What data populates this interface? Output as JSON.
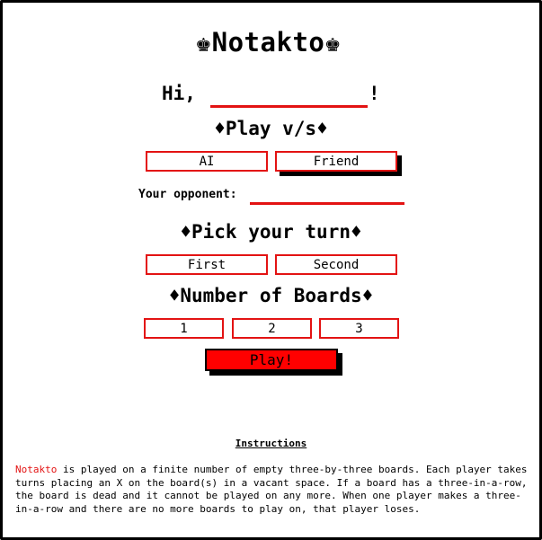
{
  "app": {
    "title": "Notakto",
    "title_icon": "chess-king-icon"
  },
  "greeting": {
    "prefix": "Hi,",
    "name_value": "",
    "suffix": "!"
  },
  "play_vs": {
    "heading": "♦Play v/s♦",
    "options": [
      "AI",
      "Friend"
    ],
    "selected": "Friend"
  },
  "opponent": {
    "label": "Your opponent:",
    "value": ""
  },
  "turn": {
    "heading": "♦Pick your turn♦",
    "options": [
      "First",
      "Second"
    ]
  },
  "boards": {
    "heading": "♦Number of Boards♦",
    "options": [
      "1",
      "2",
      "3"
    ]
  },
  "play_button": {
    "label": "Play!"
  },
  "instructions": {
    "title": "Instructions",
    "game_name": "Notakto",
    "body": " is played on a finite number of empty three-by-three boards. Each player takes turns placing an X on the board(s) in a vacant space. If a board has a three-in-a-row, the board is dead and it cannot be played on any more. When one player makes a three-in-a-row and there are no more boards to play on, that player loses."
  },
  "colors": {
    "accent": "#e31313",
    "play_button_bg": "#ff0000",
    "shadow": "#000000"
  }
}
